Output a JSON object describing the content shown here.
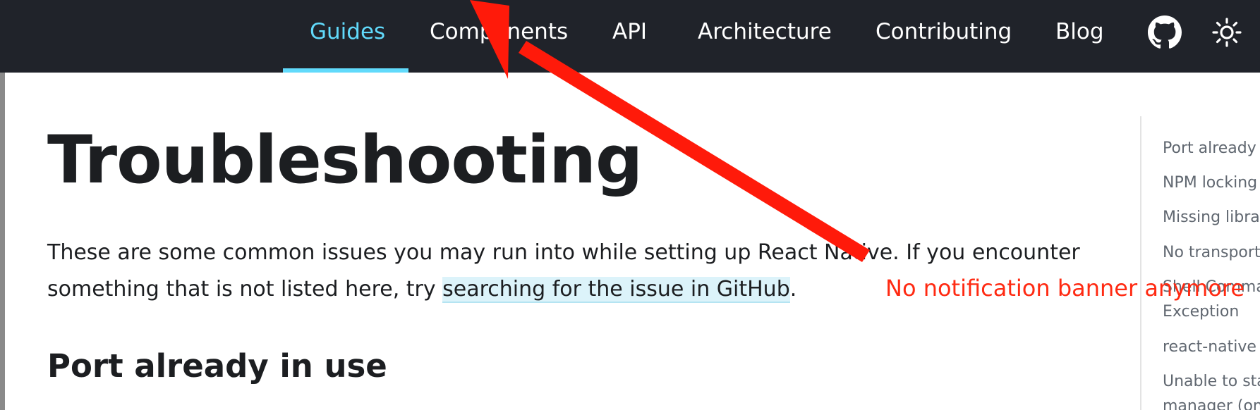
{
  "navbar": {
    "items": [
      {
        "label": "Guides",
        "active": true
      },
      {
        "label": "Components"
      },
      {
        "label": "API"
      },
      {
        "label": "Architecture"
      },
      {
        "label": "Contributing"
      },
      {
        "label": "Blog"
      }
    ],
    "icons": [
      "github-icon",
      "theme-toggle-sun-icon"
    ],
    "colors": {
      "background": "#20232a",
      "accent": "#61dafb"
    }
  },
  "main": {
    "title": "Troubleshooting",
    "intro": {
      "line1": "These are some common issues you may run into while setting up React Native. If you encounter",
      "line2_prefix": "something that is not listed here, try ",
      "link_text": "searching for the issue in GitHub",
      "line2_suffix": "."
    },
    "section_heading": "Port already in use"
  },
  "toc": {
    "items": [
      "Port already in",
      "NPM locking e",
      "Missing librari",
      "No transports",
      "Shell Comma",
      "Exception",
      "react-native in",
      "Unable to star",
      "manager (on L"
    ]
  },
  "annotation": {
    "text": "No notification banner anymore",
    "color": "#ff2a12"
  }
}
